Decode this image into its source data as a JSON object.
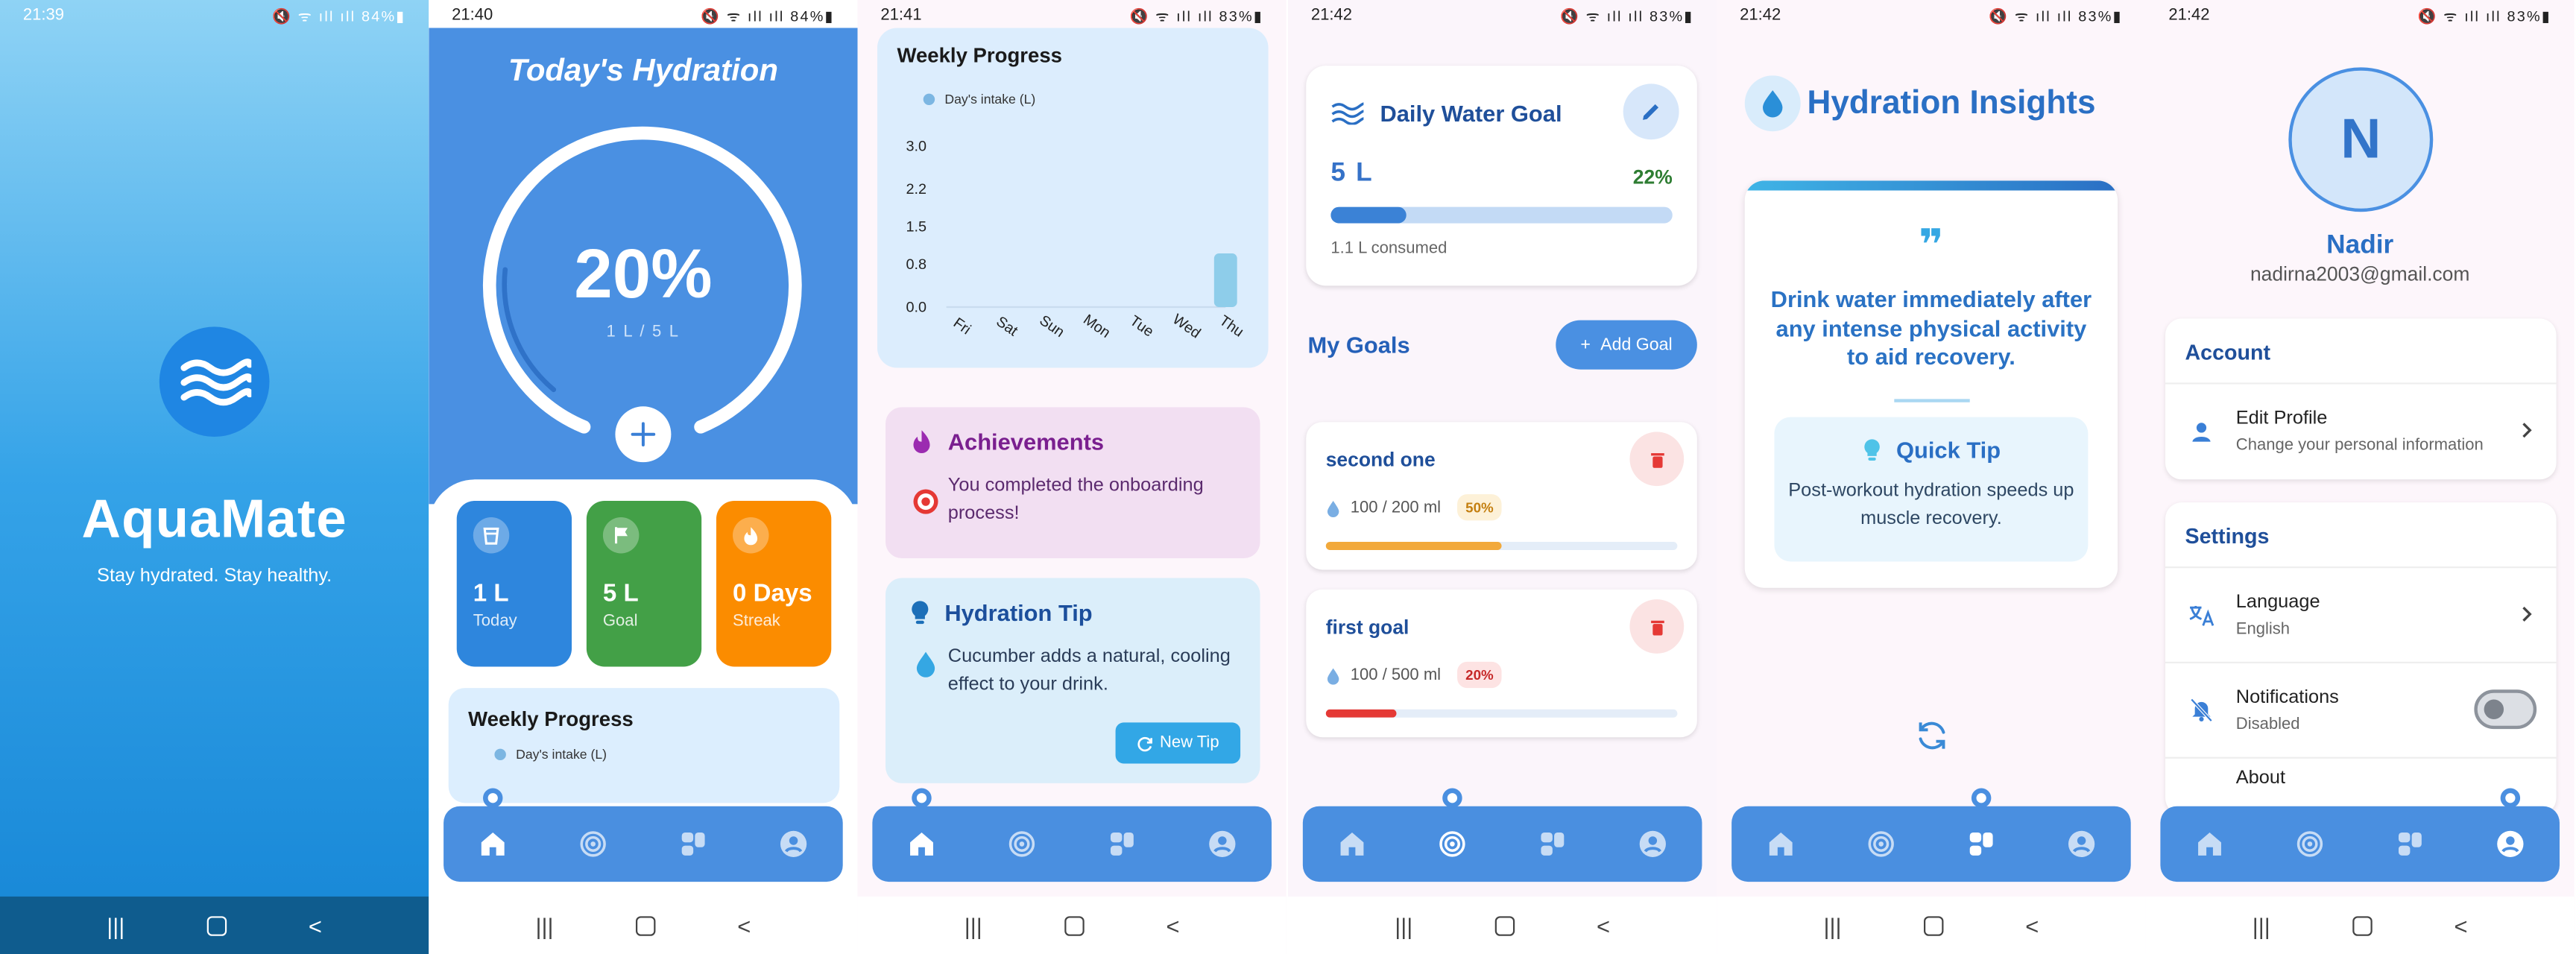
{
  "statusbar": {
    "times": [
      "21:39",
      "21:40",
      "21:41",
      "21:42",
      "21:42",
      "21:42"
    ],
    "battery": [
      "84%",
      "84%",
      "83%",
      "83%",
      "83%",
      "83%"
    ]
  },
  "splash": {
    "app_name": "AquaMate",
    "tagline": "Stay hydrated. Stay healthy."
  },
  "home": {
    "title": "Today's Hydration",
    "progress_percent": "20%",
    "progress_value": 0.2,
    "progress_sub": "1 L / 5 L",
    "stats": [
      {
        "value": "1 L",
        "label": "Today",
        "icon": "cup-icon",
        "color": "#2e86dd"
      },
      {
        "value": "5 L",
        "label": "Goal",
        "icon": "flag-icon",
        "color": "#43a047"
      },
      {
        "value": "0 Days",
        "label": "Streak",
        "icon": "flame-icon",
        "color": "#fb8c00"
      }
    ],
    "weekly_title": "Weekly Progress",
    "legend": "Day's intake (L)"
  },
  "dashboard": {
    "chart_title": "Weekly Progress",
    "legend": "Day's intake (L)",
    "achievements_title": "Achievements",
    "achievements_text": "You completed the onboarding process!",
    "tip_title": "Hydration Tip",
    "tip_text": "Cucumber adds a natural, cooling effect to your drink.",
    "new_tip_label": "New Tip"
  },
  "chart_data": {
    "type": "bar",
    "categories": [
      "Fri",
      "Sat",
      "Sun",
      "Mon",
      "Tue",
      "Wed",
      "Thu"
    ],
    "values": [
      0,
      0,
      0,
      0,
      0,
      0,
      1.0
    ],
    "yticks": [
      "3.0",
      "2.2",
      "1.5",
      "0.8",
      "0.0"
    ],
    "ylim": [
      0,
      3
    ],
    "title": "Weekly Progress",
    "legend": [
      "Day's intake (L)"
    ],
    "xlabel": "",
    "ylabel": "",
    "color": "#8ecdea"
  },
  "goals": {
    "daily_title": "Daily Water Goal",
    "daily_value": "5 L",
    "daily_percent": "22%",
    "daily_fraction": 0.22,
    "consumed": "1.1 L consumed",
    "my_goals": "My Goals",
    "add_goal_label": "Add Goal",
    "items": [
      {
        "name": "second one",
        "progress": "100 / 200 ml",
        "percent": "50%",
        "fraction": 0.5,
        "color": "#f2a93b",
        "chip_bg": "#fdf1d8",
        "chip_fg": "#c47f10"
      },
      {
        "name": "first goal",
        "progress": "100 / 500 ml",
        "percent": "20%",
        "fraction": 0.2,
        "color": "#e53935",
        "chip_bg": "#fde3e3",
        "chip_fg": "#c62828"
      }
    ]
  },
  "insights": {
    "title": "Hydration Insights",
    "quote": "Drink water immediately after any intense physical activity to aid recovery.",
    "quick_tip_title": "Quick Tip",
    "quick_tip_text": "Post-workout hydration speeds up muscle recovery."
  },
  "profile": {
    "initial": "N",
    "name": "Nadir",
    "email": "nadirna2003@gmail.com",
    "account_title": "Account",
    "edit_profile": "Edit Profile",
    "edit_profile_sub": "Change your personal information",
    "settings_title": "Settings",
    "language": "Language",
    "language_value": "English",
    "notifications": "Notifications",
    "notifications_value": "Disabled",
    "about_partial": "About"
  },
  "colors": {
    "primary": "#4a90e2",
    "nav_active": "#ffffff",
    "nav_inactive": "#c7dcf5"
  }
}
